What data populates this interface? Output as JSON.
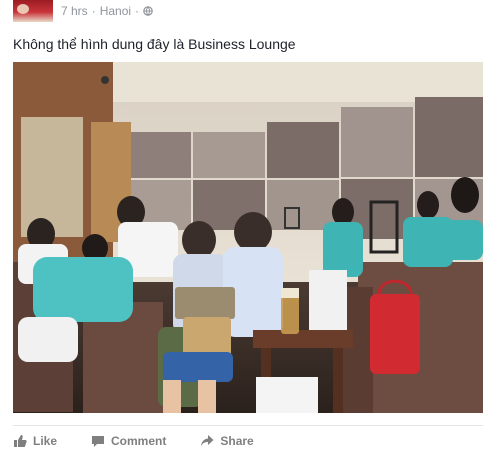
{
  "post": {
    "time": "7 hrs",
    "separator": "·",
    "location": "Hanoi",
    "privacy_icon": "globe-icon",
    "caption": "Không thể hình dung đây là Business Lounge"
  },
  "actions": {
    "like_label": "Like",
    "comment_label": "Comment",
    "share_label": "Share"
  }
}
